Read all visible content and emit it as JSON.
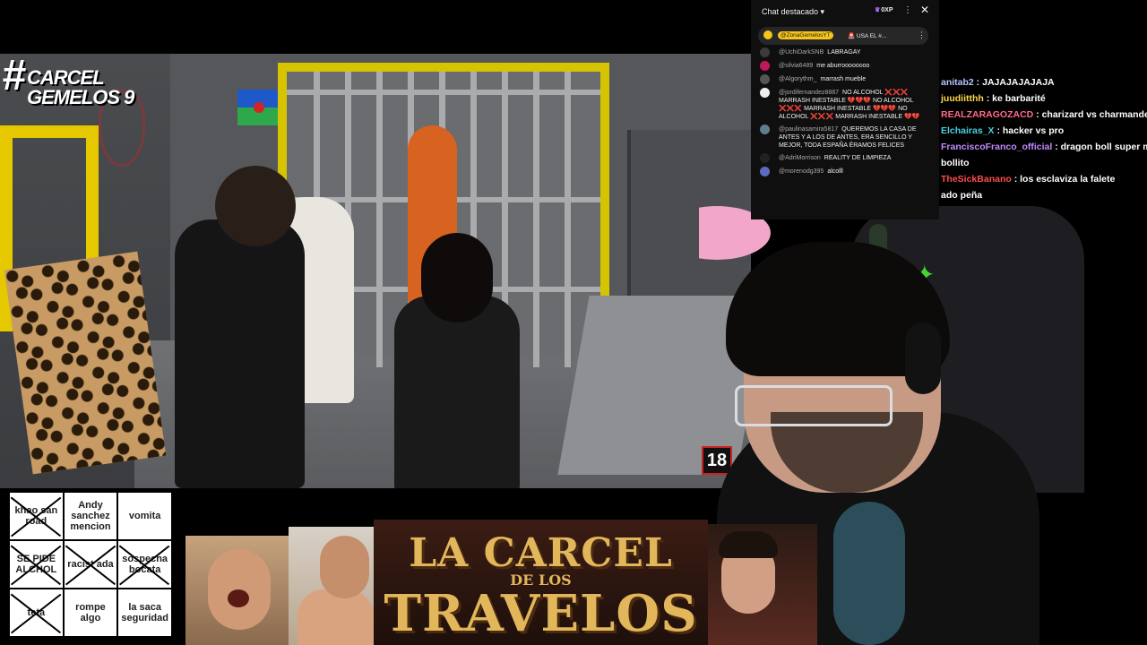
{
  "video": {
    "logo_line1": "CARCEL",
    "logo_line2": "GEMELOS 9",
    "logo_hash": "#",
    "age_badge": "18"
  },
  "chat_popup": {
    "header": "Chat destacado",
    "xp": "0XP",
    "pinned": {
      "user": "@ZonaGemelosYT",
      "text": "USA EL #..."
    },
    "messages": [
      {
        "user": "@UchiDarkSNB",
        "text": "LABRAGAY",
        "avatar_color": "#3b3b3b"
      },
      {
        "user": "@silvia6489",
        "text": "me aburroooooooo",
        "avatar_color": "#c2185b"
      },
      {
        "user": "@Algorythm_",
        "text": "marrash mueble",
        "avatar_color": "#555555"
      },
      {
        "user": "@jordifernandez8887",
        "text": "NO ALCOHOL ❌❌❌ MARRASH INESTABLE 💔💔💔 NO ALCOHOL ❌❌❌ MARRASH INESTABLE 💔💔💔 NO ALCOHOL ❌❌❌ MARRASH INESTABLE 💔💔",
        "avatar_color": "#eeeeee"
      },
      {
        "user": "@paulinasamira5817",
        "text": "QUEREMOS LA CASA DE ANTES Y A LOS DE ANTES, ERA SENCILLO Y MEJOR, TODA ESPAÑA ÉRAMOS FELICES",
        "avatar_color": "#607d8b"
      },
      {
        "user": "@AdriMorrison",
        "text": "REALITY DE LIMPIEZA",
        "avatar_color": "#222222"
      },
      {
        "user": "@morenodg395",
        "text": "alcolll",
        "avatar_color": "#5c6bc0"
      }
    ]
  },
  "stream_chat": [
    {
      "user": "anitab2",
      "text": "JAJAJAJAJAJA",
      "color": "#b5c5ff"
    },
    {
      "user": "juudiitthh",
      "text": "ke barbarité",
      "color": "#ffd84d"
    },
    {
      "user": "REALZARAGOZACD",
      "text": "charizard vs charmander",
      "color": "#ff6b8a"
    },
    {
      "user": "Elchairas_X",
      "text": "hacker vs pro",
      "color": "#4dd0e1"
    },
    {
      "user": "FranciscoFranco_official",
      "text": "dragon boll super meg",
      "color": "#c08aff"
    },
    {
      "user": "",
      "text": "bollito",
      "color": "#ffffff"
    },
    {
      "user": "TheSickBanano",
      "text": "los esclaviza la falete",
      "color": "#ff4d4d"
    },
    {
      "user": "",
      "text": "ado peña",
      "color": "#ffffff"
    }
  ],
  "bingo": [
    {
      "text": "khao san road",
      "crossed": true
    },
    {
      "text": "Andy sanchez mencion",
      "crossed": false
    },
    {
      "text": "vomita",
      "crossed": false
    },
    {
      "text": "SE PIDE ALCHOL",
      "crossed": true
    },
    {
      "text": "racist ada",
      "crossed": true
    },
    {
      "text": "sospecha bocata",
      "crossed": true
    },
    {
      "text": "teta",
      "crossed": true
    },
    {
      "text": "rompe algo",
      "crossed": false
    },
    {
      "text": "la saca seguridad",
      "crossed": false
    }
  ],
  "banner": {
    "line1": "LA CARCEL",
    "line2": "DE LOS",
    "line3": "TRAVELOS"
  }
}
